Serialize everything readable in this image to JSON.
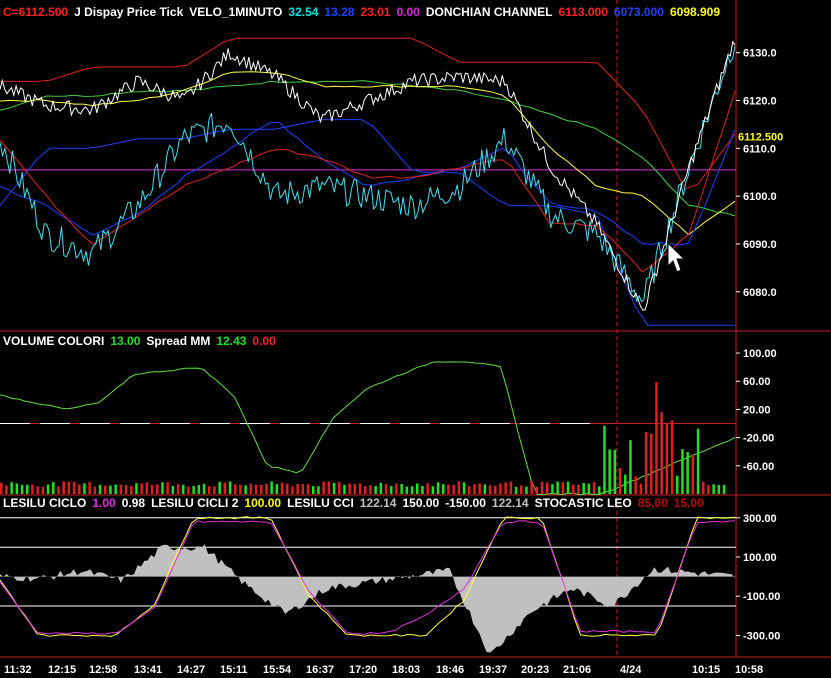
{
  "chart_data": [
    {
      "type": "line",
      "panel": "price",
      "header": [
        {
          "text": "C=6112.500",
          "color": "#ff2020"
        },
        {
          "text": "J Dispay Price Tick",
          "color": "#ffffff"
        },
        {
          "text": "VELO_1MINUTO",
          "color": "#ffffff"
        },
        {
          "text": "32.54",
          "color": "#00e0e0"
        },
        {
          "text": "13.28",
          "color": "#2040ff"
        },
        {
          "text": "23.01",
          "color": "#ff2020"
        },
        {
          "text": "0.00",
          "color": "#e020e0"
        },
        {
          "text": "DONCHIAN CHANNEL",
          "color": "#ffffff"
        },
        {
          "text": "6113.000",
          "color": "#ff2020"
        },
        {
          "text": "6073.000",
          "color": "#2040ff"
        },
        {
          "text": "6098.909",
          "color": "#ffff00"
        }
      ],
      "ylim": [
        6072,
        6136
      ],
      "y_ticks": [
        "6130.0",
        "6120.0",
        "6110.0",
        "6100.0",
        "6090.0",
        "6080.0"
      ],
      "y_tick_values": [
        6130,
        6120,
        6110,
        6100,
        6090,
        6080
      ],
      "last_price_label": "6112.500",
      "last_price": 6112.5,
      "colors": {
        "price": "#ffffff",
        "velo": "#40e0f0",
        "velo_ma": "#2040ff",
        "velo_ma2": "#e02020",
        "donch_hi": "#e02020",
        "donch_lo": "#2040ff",
        "donch_mid": "#ffff40",
        "green": "#40d040",
        "magenta": "#e030e0"
      }
    },
    {
      "type": "bar",
      "panel": "volume",
      "header": [
        {
          "text": "VOLUME COLORI",
          "color": "#ffffff"
        },
        {
          "text": "13.00",
          "color": "#20e020"
        },
        {
          "text": "Spread MM",
          "color": "#ffffff"
        },
        {
          "text": "12.43",
          "color": "#20e020"
        },
        {
          "text": "0.00",
          "color": "#ff2020"
        }
      ],
      "ylim": [
        -100,
        110
      ],
      "y_ticks": [
        "100.00",
        "60.00",
        "20.00",
        "-20.00",
        "-60.00"
      ],
      "y_tick_values": [
        100,
        60,
        20,
        -20,
        -60
      ]
    },
    {
      "type": "area",
      "panel": "oscillators",
      "header": [
        {
          "text": "LESILU CICLO",
          "color": "#ffffff"
        },
        {
          "text": "1.00",
          "color": "#e030e0"
        },
        {
          "text": "0.98",
          "color": "#ffffff"
        },
        {
          "text": "LESILU CICLI 2",
          "color": "#ffffff"
        },
        {
          "text": "100.00",
          "color": "#ffff00"
        },
        {
          "text": "LESILU CCI",
          "color": "#ffffff"
        },
        {
          "text": "122.14",
          "color": "#c0c0c0"
        },
        {
          "text": "150.00",
          "color": "#ffffff"
        },
        {
          "text": "-150.00",
          "color": "#ffffff"
        },
        {
          "text": "122.14",
          "color": "#c0c0c0"
        },
        {
          "text": "STOCASTIC LEO",
          "color": "#ffffff"
        },
        {
          "text": "85.00",
          "color": "#c00000"
        },
        {
          "text": "15.00",
          "color": "#c00000"
        }
      ],
      "ylim": [
        -400,
        350
      ],
      "y_ticks": [
        "300.00",
        "100.00",
        "-100.00",
        "-300.00"
      ],
      "y_tick_values": [
        300,
        100,
        -100,
        -300
      ]
    }
  ],
  "time_axis": [
    "11:32",
    "12:15",
    "12:58",
    "13:41",
    "14:27",
    "15:11",
    "15:54",
    "16:37",
    "17:20",
    "18:03",
    "18:46",
    "19:37",
    "20:23",
    "21:06",
    "4/24",
    "10:15",
    "10:58"
  ]
}
